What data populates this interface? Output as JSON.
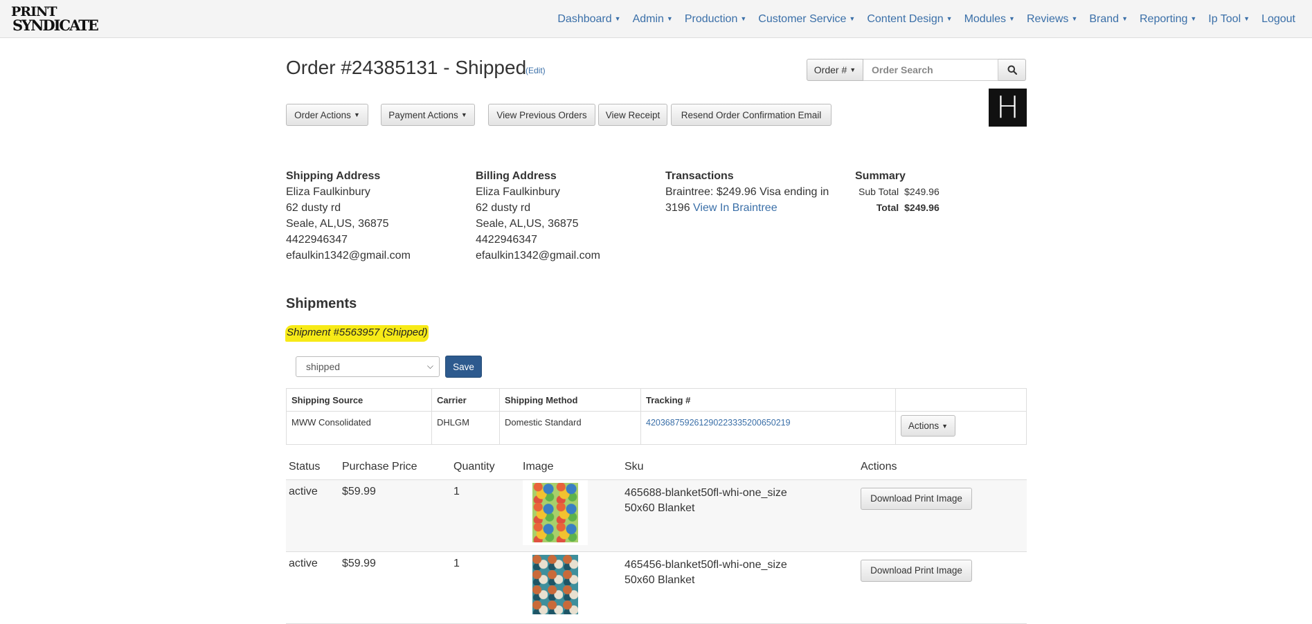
{
  "nav": {
    "logo": {
      "line1": "PRINT",
      "line2": "SYNDICATE"
    },
    "items": [
      {
        "label": "Dashboard",
        "dropdown": true
      },
      {
        "label": "Admin",
        "dropdown": true
      },
      {
        "label": "Production",
        "dropdown": true
      },
      {
        "label": "Customer Service",
        "dropdown": true
      },
      {
        "label": "Content Design",
        "dropdown": true
      },
      {
        "label": "Modules",
        "dropdown": true
      },
      {
        "label": "Reviews",
        "dropdown": true
      },
      {
        "label": "Brand",
        "dropdown": true
      },
      {
        "label": "Reporting",
        "dropdown": true
      },
      {
        "label": "Ip Tool",
        "dropdown": true
      },
      {
        "label": "Logout",
        "dropdown": false
      }
    ]
  },
  "header": {
    "title": "Order #24385131 - Shipped",
    "edit_label": "(Edit)",
    "order_num_label": "Order #",
    "search_placeholder": "Order Search",
    "brand_letter": "H"
  },
  "actions": {
    "order_actions": "Order Actions",
    "payment_actions": "Payment Actions",
    "view_previous_orders": "View Previous Orders",
    "view_receipt": "View Receipt",
    "resend_confirmation": "Resend Order Confirmation Email"
  },
  "shipping_address": {
    "heading": "Shipping Address",
    "name": "Eliza Faulkinbury",
    "street": "62 dusty rd",
    "city_line": "Seale, AL,US, 36875",
    "phone": "4422946347",
    "email": "efaulkin1342@gmail.com"
  },
  "billing_address": {
    "heading": "Billing Address",
    "name": "Eliza Faulkinbury",
    "street": "62 dusty rd",
    "city_line": "Seale, AL,US, 36875",
    "phone": "4422946347",
    "email": "efaulkin1342@gmail.com"
  },
  "transactions": {
    "heading": "Transactions",
    "line1": "Braintree: $249.96 Visa ending in",
    "line2": "3196",
    "link": "View In Braintree"
  },
  "summary": {
    "heading": "Summary",
    "subtotal_label": "Sub Total",
    "subtotal_value": "$249.96",
    "total_label": "Total",
    "total_value": "$249.96"
  },
  "shipments": {
    "heading": "Shipments",
    "shipment_label": "Shipment #5563957 (Shipped)",
    "status_value": "shipped",
    "save_label": "Save",
    "columns": {
      "source": "Shipping Source",
      "carrier": "Carrier",
      "method": "Shipping Method",
      "tracking": "Tracking #"
    },
    "row": {
      "source": "MWW Consolidated",
      "carrier": "DHLGM",
      "method": "Domestic Standard",
      "tracking": "420368759261290223335200650219",
      "actions": "Actions"
    }
  },
  "items": {
    "columns": {
      "status": "Status",
      "price": "Purchase Price",
      "quantity": "Quantity",
      "image": "Image",
      "sku": "Sku",
      "actions": "Actions"
    },
    "rows": [
      {
        "status": "active",
        "price": "$59.99",
        "quantity": "1",
        "sku": "465688-blanket50fl-whi-one_size",
        "product": "50x60 Blanket",
        "action": "Download Print Image"
      },
      {
        "status": "active",
        "price": "$59.99",
        "quantity": "1",
        "sku": "465456-blanket50fl-whi-one_size",
        "product": "50x60 Blanket",
        "action": "Download Print Image"
      }
    ]
  }
}
